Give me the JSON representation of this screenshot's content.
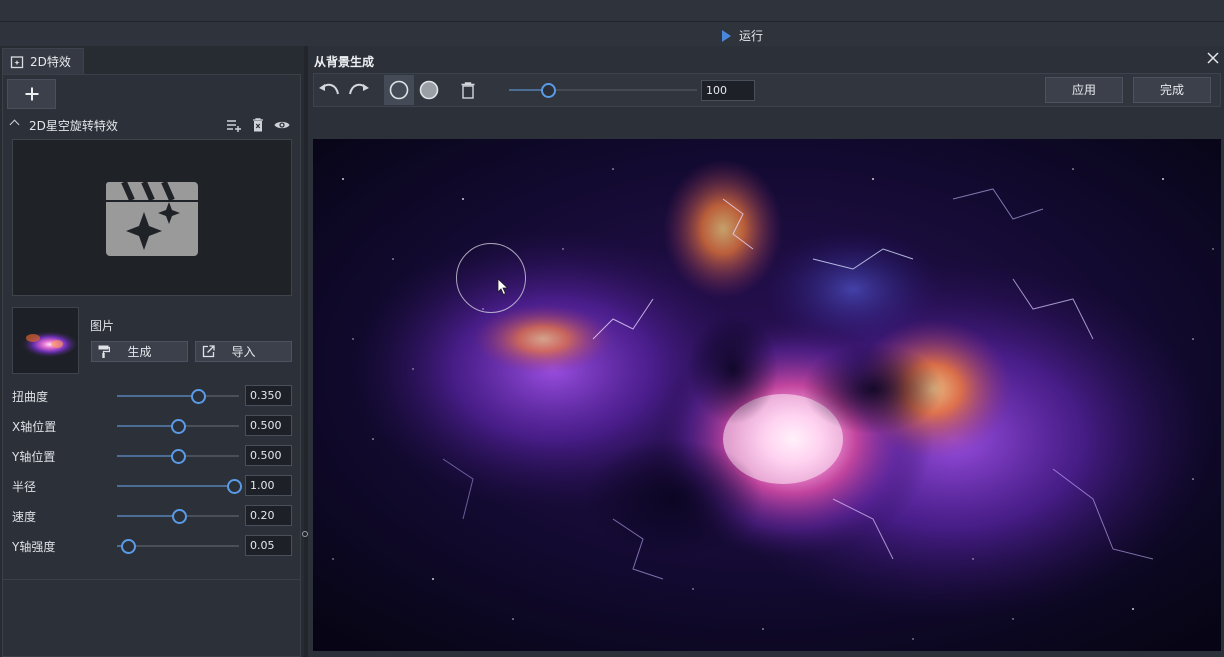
{
  "runbar": {
    "run_label": "运行"
  },
  "left_panel": {
    "tab_label": "2D特效",
    "effect_title": "2D星空旋转特效",
    "image_label": "图片",
    "generate_label": "生成",
    "import_label": "导入",
    "params": [
      {
        "label": "扭曲度",
        "value": "0.350",
        "fraction": 0.66
      },
      {
        "label": "X轴位置",
        "value": "0.500",
        "fraction": 0.5
      },
      {
        "label": "Y轴位置",
        "value": "0.500",
        "fraction": 0.5
      },
      {
        "label": "半径",
        "value": "1.00",
        "fraction": 0.96
      },
      {
        "label": "速度",
        "value": "0.20",
        "fraction": 0.51
      },
      {
        "label": "Y轴强度",
        "value": "0.05",
        "fraction": 0.09
      }
    ]
  },
  "right_panel": {
    "title": "从背景生成",
    "brush_size": "100",
    "apply_label": "应用",
    "done_label": "完成"
  },
  "colors": {
    "accent": "#5b9ae6",
    "run_icon": "#4a86d9",
    "panel_bg": "#2c3038"
  },
  "icons": [
    "play-icon",
    "effect-tab-icon",
    "plus-icon",
    "chevron-up-icon",
    "add-list-icon",
    "delete-icon",
    "eye-icon",
    "effect-clapper-icon",
    "paint-roller-icon",
    "external-link-icon",
    "undo-icon",
    "redo-icon",
    "brush-circle-outline-icon",
    "brush-circle-filled-icon",
    "trash-icon",
    "close-icon",
    "mouse-pointer-icon"
  ]
}
